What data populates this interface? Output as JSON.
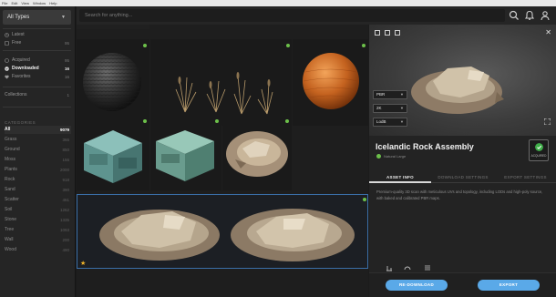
{
  "menubar": [
    "File",
    "Edit",
    "View",
    "Window",
    "Help"
  ],
  "sidebar": {
    "type_select": "All Types",
    "nav": [
      {
        "label": "Latest",
        "count": "",
        "icon": "clock-icon"
      },
      {
        "label": "Free",
        "count": "95",
        "icon": "tag-icon"
      },
      {
        "label": "Acquired",
        "count": "95",
        "icon": "download-circle-icon"
      },
      {
        "label": "Downloaded",
        "count": "16",
        "icon": "check-circle-icon",
        "active": true
      },
      {
        "label": "Favorites",
        "count": "16",
        "icon": "heart-icon"
      }
    ],
    "collections": {
      "label": "Collections",
      "count": "1"
    },
    "categories_header": "CATEGORIES",
    "categories": [
      {
        "label": "All",
        "count": "9079",
        "active": true
      },
      {
        "label": "Grass",
        "count": "366"
      },
      {
        "label": "Ground",
        "count": "850"
      },
      {
        "label": "Moss",
        "count": "156"
      },
      {
        "label": "Plants",
        "count": "2000"
      },
      {
        "label": "Rock",
        "count": "918"
      },
      {
        "label": "Sand",
        "count": "390"
      },
      {
        "label": "Scatter",
        "count": "461"
      },
      {
        "label": "Soil",
        "count": "1262"
      },
      {
        "label": "Stone",
        "count": "1335"
      },
      {
        "label": "Tree",
        "count": "1093"
      },
      {
        "label": "Wall",
        "count": "200"
      },
      {
        "label": "Wood",
        "count": "490"
      }
    ]
  },
  "topbar": {
    "search_placeholder": "Search for anything..."
  },
  "grid": {
    "tiles": [
      {
        "name": "dark-rock-sphere"
      },
      {
        "name": "dry-grass-plants"
      },
      {
        "name": "wood-sphere"
      },
      {
        "name": "teal-metal-crate-1"
      },
      {
        "name": "teal-metal-crate-2"
      },
      {
        "name": "rock-scan-small"
      },
      {
        "name": "icelandic-rock-assembly",
        "selected": true,
        "favorite": true
      }
    ]
  },
  "panel": {
    "dropdowns": [
      "PBR",
      "2K",
      "LodB"
    ],
    "title": "Icelandic Rock Assembly",
    "subtitle": "Natural Large",
    "badge_label": "ACQUIRED",
    "tabs": [
      "ASSET INFO",
      "DOWNLOAD SETTINGS",
      "EXPORT SETTINGS"
    ],
    "description": "Premium-quality 3D scan with meticulous UVs and topology, including LODs and high-poly source, with baked and calibrated PBR maps.",
    "stats": [
      {
        "label": "SCALE",
        "icon": "scale-icon"
      },
      {
        "label": "SPEED",
        "icon": "speed-icon"
      },
      {
        "label": "DENSITY",
        "icon": "density-icon"
      }
    ],
    "download_button": "RE-DOWNLOAD",
    "export_button": "EXPORT"
  },
  "colors": {
    "accent": "#5aa9e8",
    "acquired": "#6cc04a",
    "favorite": "#f0b429"
  }
}
